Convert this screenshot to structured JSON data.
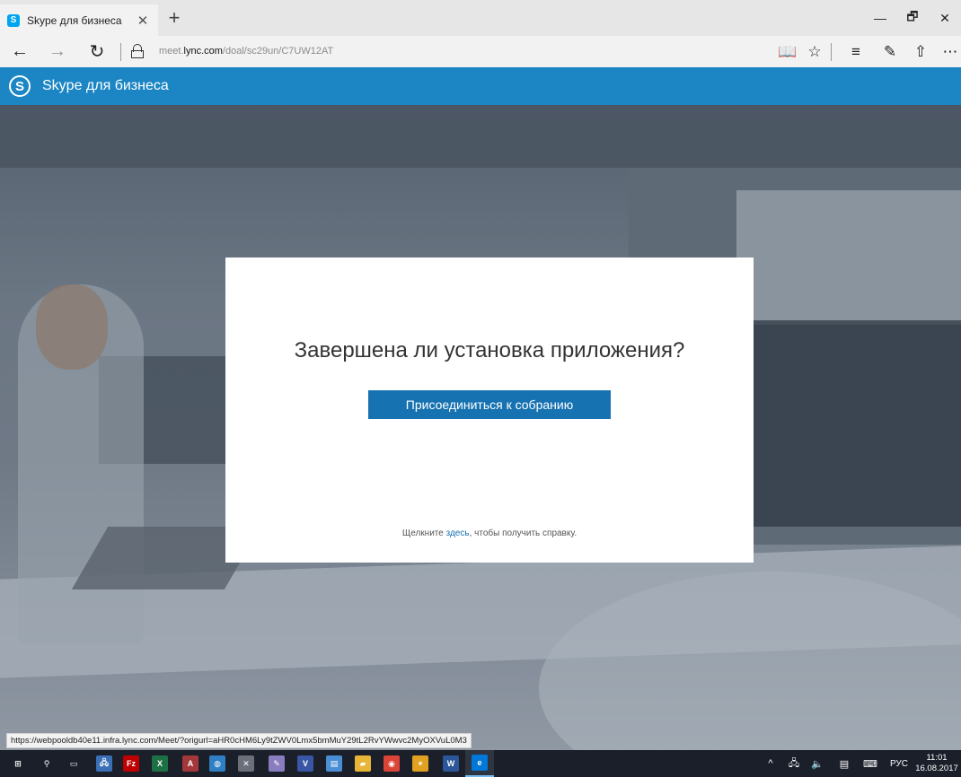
{
  "browser": {
    "tab": {
      "favicon_letter": "S",
      "title": "Skype для бизнеса",
      "close": "✕"
    },
    "new_tab": "+",
    "window_controls": {
      "minimize": "—",
      "maximize": "🗗",
      "close": "✕"
    },
    "nav": {
      "back": "←",
      "forward": "→",
      "refresh": "↻"
    },
    "address": {
      "prefix": "meet.",
      "domain": "lync.com",
      "path": "/doal/sc29un/C7UW12AT"
    },
    "tools": {
      "reading_view": "📖",
      "favorite": "☆",
      "hub": "≡",
      "web_note": "✎",
      "share": "⇧",
      "more": "⋯"
    }
  },
  "app_header": {
    "logo_letter": "S",
    "title": "Skype для бизнеса"
  },
  "dialog": {
    "title": "Завершена ли установка приложения?",
    "join_button": "Присоединиться к собранию",
    "help_prefix": "Щелкните ",
    "help_link": "здесь",
    "help_suffix": ", чтобы получить справку."
  },
  "status_url": "https://webpooldb40e11.infra.lync.com/Meet/?origurl=aHR0cHM6Ly9tZWV0Lmx5bmMuY29tL2RvYWwvc2MyOXVuL0M3",
  "taskbar": {
    "apps": [
      {
        "name": "start",
        "glyph": "⊞",
        "color": "#1a1f2a"
      },
      {
        "name": "search",
        "glyph": "⚲",
        "color": "#1a1f2a"
      },
      {
        "name": "task-view",
        "glyph": "▭",
        "color": "#1a1f2a"
      },
      {
        "name": "network-app",
        "glyph": "🖧",
        "color": "#3b6fb6"
      },
      {
        "name": "filezilla",
        "glyph": "Fz",
        "color": "#bf0000"
      },
      {
        "name": "excel",
        "glyph": "X",
        "color": "#1d7044"
      },
      {
        "name": "access",
        "glyph": "A",
        "color": "#a4373a"
      },
      {
        "name": "app-blue",
        "glyph": "◍",
        "color": "#2e7fc4"
      },
      {
        "name": "tools",
        "glyph": "✕",
        "color": "#6a6f7a"
      },
      {
        "name": "app-paint",
        "glyph": "✎",
        "color": "#8a7dbf"
      },
      {
        "name": "visio",
        "glyph": "V",
        "color": "#3955a3"
      },
      {
        "name": "app-window",
        "glyph": "▤",
        "color": "#4a8fd4"
      },
      {
        "name": "file-explorer",
        "glyph": "▰",
        "color": "#e8b537"
      },
      {
        "name": "chrome",
        "glyph": "◉",
        "color": "#db4437"
      },
      {
        "name": "app-star",
        "glyph": "✶",
        "color": "#e0a020"
      },
      {
        "name": "word",
        "glyph": "W",
        "color": "#2b579a"
      },
      {
        "name": "edge",
        "glyph": "e",
        "color": "#0078d7"
      }
    ],
    "tray": {
      "chevron": "^",
      "network": "🖧",
      "volume": "🔈",
      "notifications": "▤",
      "keyboard": "⌨",
      "language": "РУС"
    },
    "clock": {
      "time": "11:01",
      "date": "16.08.2017"
    }
  }
}
